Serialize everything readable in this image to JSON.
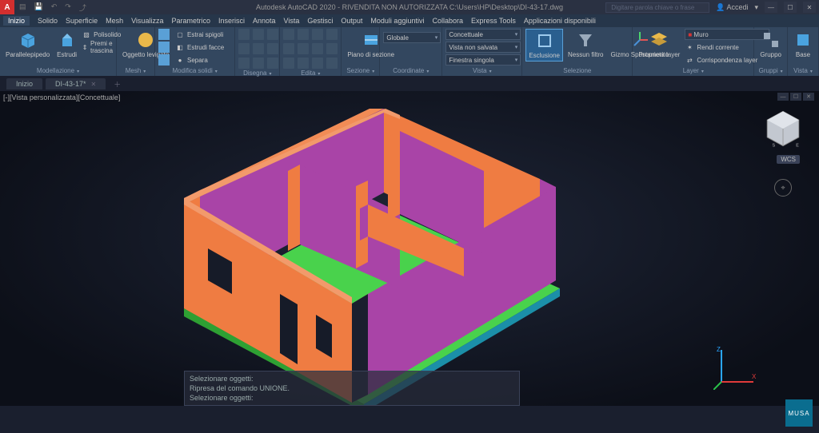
{
  "title": {
    "app_icon_letter": "A",
    "center": "Autodesk AutoCAD 2020 - RIVENDITA NON AUTORIZZATA   C:\\Users\\HP\\Desktop\\DI-43-17.dwg",
    "search_placeholder": "Digitare parola chiave o frase",
    "signin": "Accedi"
  },
  "menubar": {
    "items": [
      "Inizio",
      "Solido",
      "Superficie",
      "Mesh",
      "Visualizza",
      "Parametrico",
      "Inserisci",
      "Annota",
      "Vista",
      "Gestisci",
      "Output",
      "Moduli aggiuntivi",
      "Collabora",
      "Express Tools",
      "Applicazioni disponibili"
    ]
  },
  "ribbon": {
    "p_model": {
      "title": "Modellazione",
      "parallelepipedo": "Parallelepipedo",
      "estrudi": "Estrudi",
      "polisolido": "Polisolido",
      "premi_trascina": "Premi e trascina"
    },
    "p_mesh": {
      "title": "Mesh",
      "oggetto": "Oggetto levigato"
    },
    "p_modifica": {
      "title": "Modifica solidi",
      "estrai_spigoli": "Estrai spigoli",
      "estrudi_facce": "Estrudi facce",
      "separa": "Separa"
    },
    "p_disegna": {
      "title": "Disegna"
    },
    "p_edita": {
      "title": "Edita"
    },
    "p_sezione": {
      "title": "Sezione",
      "piano": "Piano di sezione"
    },
    "p_coord": {
      "title": "Coordinate",
      "dd_globale": "Globale"
    },
    "p_vista": {
      "title": "Vista",
      "dd_concettuale": "Concettuale",
      "dd_nonsalvata": "Vista non salvata",
      "dd_finestra": "Finestra singola"
    },
    "p_sel": {
      "title": "Selezione",
      "esclusione": "Esclusione",
      "nessun_filtro": "Nessun filtro",
      "gizmo": "Gizmo Spostamento"
    },
    "p_layer": {
      "title": "Layer",
      "proprieta": "Proprietà layer",
      "dd_muro": "Muro",
      "rendi": "Rendi corrente",
      "corr": "Corrispondenza layer"
    },
    "p_gruppi": {
      "title": "Gruppi",
      "gruppo": "Gruppo"
    },
    "p_vista2": {
      "title": "Vista",
      "base": "Base"
    }
  },
  "filetabs": {
    "home": "Inizio",
    "tab1": "DI-43-17*"
  },
  "viewport": {
    "label_tl": "[-][Vista personalizzata][Concettuale]",
    "vc_badge": "WCS"
  },
  "cmdline": {
    "l1": "Selezionare oggetti:",
    "l2": "Ripresa del comando UNIONE.",
    "l3": "Selezionare oggetti:"
  },
  "badge": "MUSA"
}
